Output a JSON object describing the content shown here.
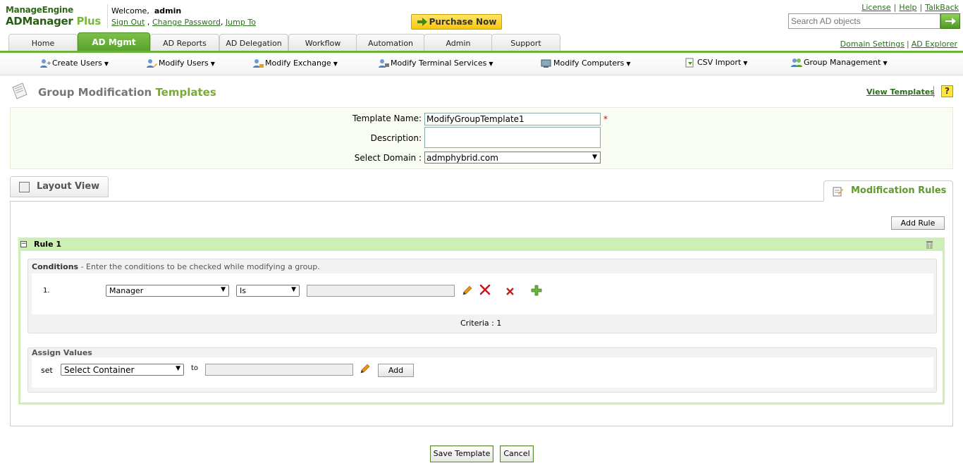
{
  "header": {
    "logo_top": "ManageEngine",
    "logo_main": "ADManager",
    "logo_plus": " Plus",
    "welcome_prefix": "Welcome,",
    "username": "admin",
    "sign_out": "Sign Out",
    "change_password": "Change Password",
    "jump_to": "Jump To",
    "purchase": "Purchase Now",
    "license": "License",
    "help": "Help",
    "talkback": "TalkBack",
    "search_placeholder": "Search AD objects",
    "domain_settings": "Domain Settings",
    "ad_explorer": "AD Explorer"
  },
  "tabs": [
    "Home",
    "AD Mgmt",
    "AD Reports",
    "AD Delegation",
    "Workflow",
    "Automation",
    "Admin",
    "Support"
  ],
  "active_tab": "AD Mgmt",
  "submenu": [
    "Create Users",
    "Modify Users",
    "Modify Exchange",
    "Modify Terminal Services",
    "Modify Computers",
    "CSV Import",
    "Group Management"
  ],
  "page": {
    "title_part1": "Group Modification",
    "title_part2": "Templates",
    "view_templates": "View Templates",
    "help_glyph": "?"
  },
  "form": {
    "template_name_label": "Template Name:",
    "template_name_value": "ModifyGroupTemplate1",
    "required_mark": "*",
    "description_label": "Description:",
    "description_value": "",
    "domain_label": "Select Domain :",
    "domain_value": "admphybrid.com"
  },
  "views": {
    "layout_view": "Layout View",
    "modification_rules": "Modification Rules"
  },
  "rules": {
    "add_rule": "Add Rule",
    "rule_title": "Rule 1",
    "conditions_title": "Conditions",
    "conditions_hint": " - Enter the conditions to be checked while modifying a group.",
    "condition_index": "1.",
    "condition_attribute": "Manager",
    "condition_operator": "Is",
    "condition_value": "",
    "criteria": "Criteria : 1",
    "assign_title": "Assign Values",
    "set_label": "set",
    "container_value": "Select Container",
    "to_label": "to",
    "assign_value": "",
    "add_button": "Add"
  },
  "actions": {
    "save": "Save Template",
    "cancel": "Cancel"
  },
  "colors": {
    "accent_green": "#6ab43a",
    "title_green": "#7aaa3c",
    "purchase_yellow": "#f8c60b"
  }
}
